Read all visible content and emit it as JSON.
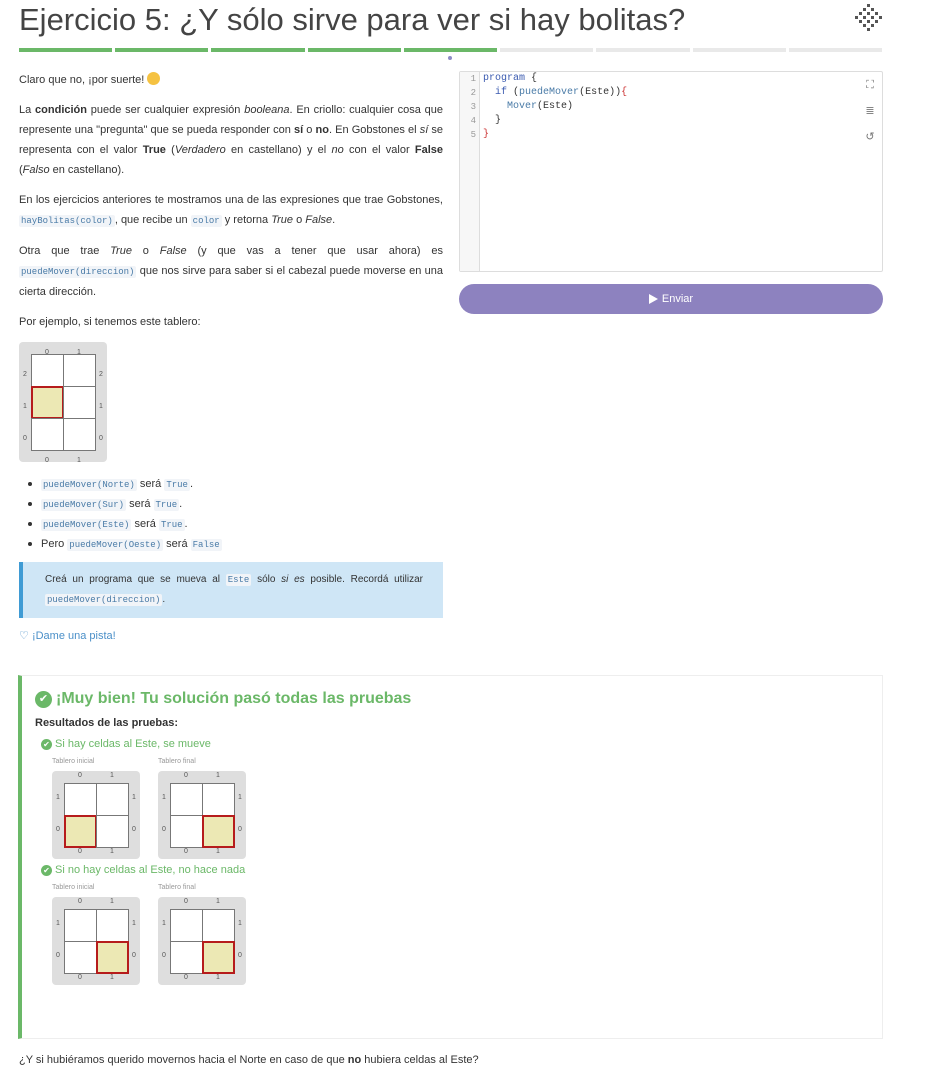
{
  "exercise": {
    "title": "Ejercicio 5: ¿Y sólo sirve para ver si hay bolitas?",
    "progress": {
      "total": 9,
      "completed": 5
    },
    "colors": {
      "accent": "#8d82bf",
      "success": "#6bb868",
      "info_border": "#3f9bd4",
      "info_bg": "#cfe6f6",
      "head": "#b61c1c"
    }
  },
  "content": {
    "p1": "Claro que no, ¡por suerte!",
    "p2": {
      "t1": "La ",
      "b1": "condición",
      "t2": " puede ser cualquier expresión ",
      "i1": "booleana",
      "t3": ". En criollo: cualquier cosa que represente una \"pregunta\" que se pueda responder con ",
      "b2": "sí",
      "t4": " o ",
      "b3": "no",
      "t5": ". En Gobstones el ",
      "i2": "sí",
      "t6": " se representa con el valor ",
      "b4": "True",
      "t7": " (",
      "i3": "Verdadero",
      "t8": " en castellano) y el ",
      "i4": "no",
      "t9": " con el valor ",
      "b5": "False",
      "t10": " (",
      "i5": "Falso",
      "t11": " en castellano)."
    },
    "p3": {
      "t1": "En los ejercicios anteriores te mostramos una de las expresiones que trae Gobstones, ",
      "c1": "hayBolitas(color)",
      "t2": ", que recibe un ",
      "c2": "color",
      "t3": " y retorna ",
      "i1": "True",
      "t4": " o ",
      "i2": "False",
      "t5": "."
    },
    "p4": {
      "t1": "Otra que trae ",
      "i1": "True",
      "t2": " o ",
      "i2": "False",
      "t3": " (y que vas a tener que usar ahora) es ",
      "c1": "puedeMover(direccion)",
      "t4": " que nos sirve para saber si el cabezal puede moverse en una cierta dirección."
    },
    "p5": "Por ejemplo, si tenemos este tablero:",
    "bullets": [
      {
        "code": "puedeMover(Norte)",
        "mid": " será ",
        "val": "True",
        "end": "."
      },
      {
        "code": "puedeMover(Sur)",
        "mid": " será ",
        "val": "True",
        "end": "."
      },
      {
        "code": "puedeMover(Este)",
        "mid": " será ",
        "val": "True",
        "end": "."
      },
      {
        "pre": "Pero ",
        "code": "puedeMover(Oeste)",
        "mid": " será ",
        "val": "False",
        "end": ""
      }
    ],
    "task": {
      "t1": "Creá un programa que se mueva al ",
      "c1": "Este",
      "t2": " sólo ",
      "i1": "si es",
      "t3": " posible. Recordá utilizar ",
      "c2": "puedeMover(direccion)",
      "t4": "."
    },
    "hint": "¡Dame una pista!",
    "question": {
      "t1": "¿Y si hubiéramos querido movernos hacia el Norte en caso de que ",
      "b1": "no",
      "t2": " hubiera celdas al Este?"
    }
  },
  "example_board": {
    "cols": 2,
    "rows": 3,
    "head": [
      0,
      1
    ],
    "col_labels": [
      "0",
      "1"
    ],
    "row_labels": [
      "2",
      "1",
      "0"
    ]
  },
  "editor": {
    "line_numbers": [
      "1",
      "2",
      "3",
      "4",
      "5"
    ],
    "lines": [
      [
        {
          "t": "program",
          "c": "kw"
        },
        {
          "t": " {",
          "c": ""
        }
      ],
      [
        {
          "t": "  ",
          "c": ""
        },
        {
          "t": "if",
          "c": "kw"
        },
        {
          "t": " (",
          "c": ""
        },
        {
          "t": "puedeMover",
          "c": "fn"
        },
        {
          "t": "(Este))",
          "c": ""
        },
        {
          "t": "{",
          "c": "br"
        }
      ],
      [
        {
          "t": "    ",
          "c": ""
        },
        {
          "t": "Mover",
          "c": "fn"
        },
        {
          "t": "(Este)",
          "c": ""
        }
      ],
      [
        {
          "t": "  }",
          "c": ""
        }
      ],
      [
        {
          "t": "}",
          "c": "br"
        }
      ]
    ],
    "tools": {
      "fullscreen": "expand-icon",
      "indent": "indent-icon",
      "reset": "reset-icon"
    },
    "submit_label": "Enviar"
  },
  "results": {
    "title": "¡Muy bien! Tu solución pasó todas las pruebas",
    "subtitle": "Resultados de las pruebas:",
    "initial_label": "Tablero inicial",
    "final_label": "Tablero final",
    "tests": [
      {
        "name": "Si hay celdas al Este, se mueve",
        "initial": {
          "cols": 2,
          "rows": 2,
          "head": [
            0,
            0
          ]
        },
        "final": {
          "cols": 2,
          "rows": 2,
          "head": [
            1,
            0
          ]
        }
      },
      {
        "name": "Si no hay celdas al Este, no hace nada",
        "initial": {
          "cols": 2,
          "rows": 2,
          "head": [
            1,
            0
          ]
        },
        "final": {
          "cols": 2,
          "rows": 2,
          "head": [
            1,
            0
          ]
        }
      }
    ],
    "col_labels": [
      "0",
      "1"
    ],
    "row_labels": [
      "1",
      "0"
    ]
  }
}
